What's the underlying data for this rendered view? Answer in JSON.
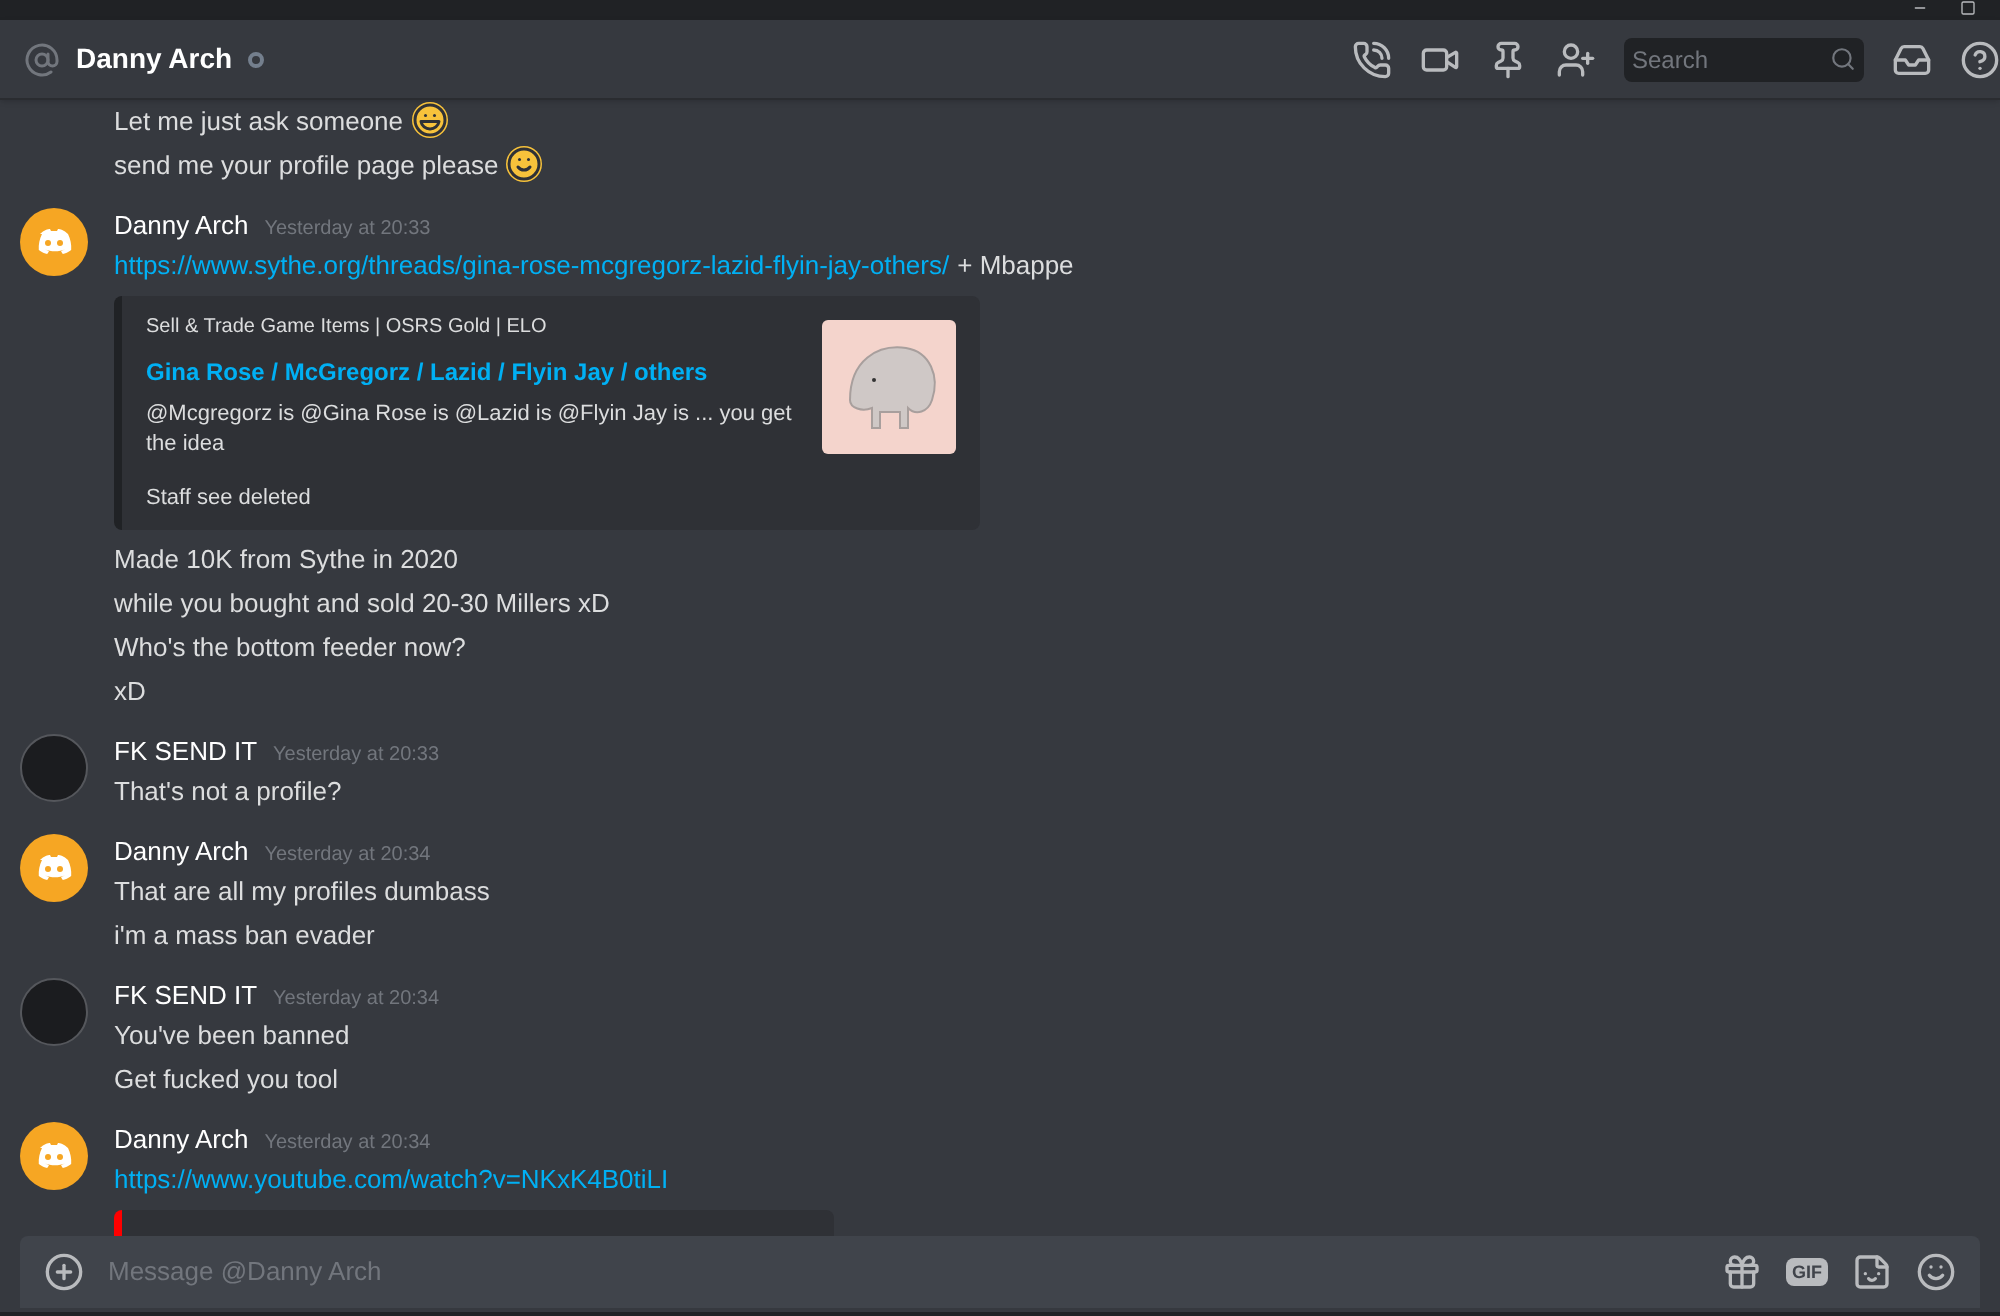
{
  "header": {
    "channel_name": "Danny Arch",
    "status": {
      "kind": "offline"
    },
    "search": {
      "placeholder": "Search"
    }
  },
  "messages": [
    {
      "lines": [
        {
          "kind": "text",
          "text": "Let me just ask someone",
          "emoji": {
            "kind": "grin"
          }
        },
        {
          "kind": "text",
          "text": "send me your profile page please",
          "emoji": {
            "kind": "smile"
          }
        }
      ]
    },
    {
      "author": "Danny Arch",
      "avatar": {
        "kind": "discord"
      },
      "timestamp": "Yesterday at 20:33",
      "lines": [
        {
          "kind": "link",
          "url": "https://www.sythe.org/threads/gina-rose-mcgregorz-lazid-flyin-jay-others/",
          "suffix": "+ Mbappe"
        },
        {
          "kind": "embed",
          "provider": "Sell & Trade Game Items | OSRS Gold | ELO",
          "title": "Gina Rose / McGregorz / Lazid / Flyin Jay / others",
          "description": "@Mcgregorz is @Gina Rose is @Lazid is @Flyin Jay is ... you get the idea",
          "footer": "Staff see deleted"
        },
        {
          "kind": "text",
          "text": "Made 10K from Sythe in 2020"
        },
        {
          "kind": "text",
          "text": "while you bought and sold 20-30 Millers xD"
        },
        {
          "kind": "text",
          "text": "Who's the bottom feeder now?"
        },
        {
          "kind": "text",
          "text": "xD"
        }
      ]
    },
    {
      "author": "FK SEND IT",
      "avatar": {
        "kind": "sticker"
      },
      "timestamp": "Yesterday at 20:33",
      "lines": [
        {
          "kind": "text",
          "text": "That's not a profile?"
        }
      ]
    },
    {
      "author": "Danny Arch",
      "avatar": {
        "kind": "discord"
      },
      "timestamp": "Yesterday at 20:34",
      "lines": [
        {
          "kind": "text",
          "text": "That are all my profiles dumbass"
        },
        {
          "kind": "text",
          "text": "i'm a mass ban evader"
        }
      ]
    },
    {
      "author": "FK SEND IT",
      "avatar": {
        "kind": "sticker"
      },
      "timestamp": "Yesterday at 20:34",
      "lines": [
        {
          "kind": "text",
          "text": "You've been banned"
        },
        {
          "kind": "text",
          "text": "Get fucked you tool"
        }
      ]
    },
    {
      "author": "Danny Arch",
      "avatar": {
        "kind": "discord"
      },
      "timestamp": "Yesterday at 20:34",
      "lines": [
        {
          "kind": "link",
          "url": "https://www.youtube.com/watch?v=NKxK4B0tiLI"
        },
        {
          "kind": "video_embed"
        }
      ]
    }
  ],
  "composer": {
    "placeholder": "Message @Danny Arch",
    "gif_label": "GIF"
  }
}
